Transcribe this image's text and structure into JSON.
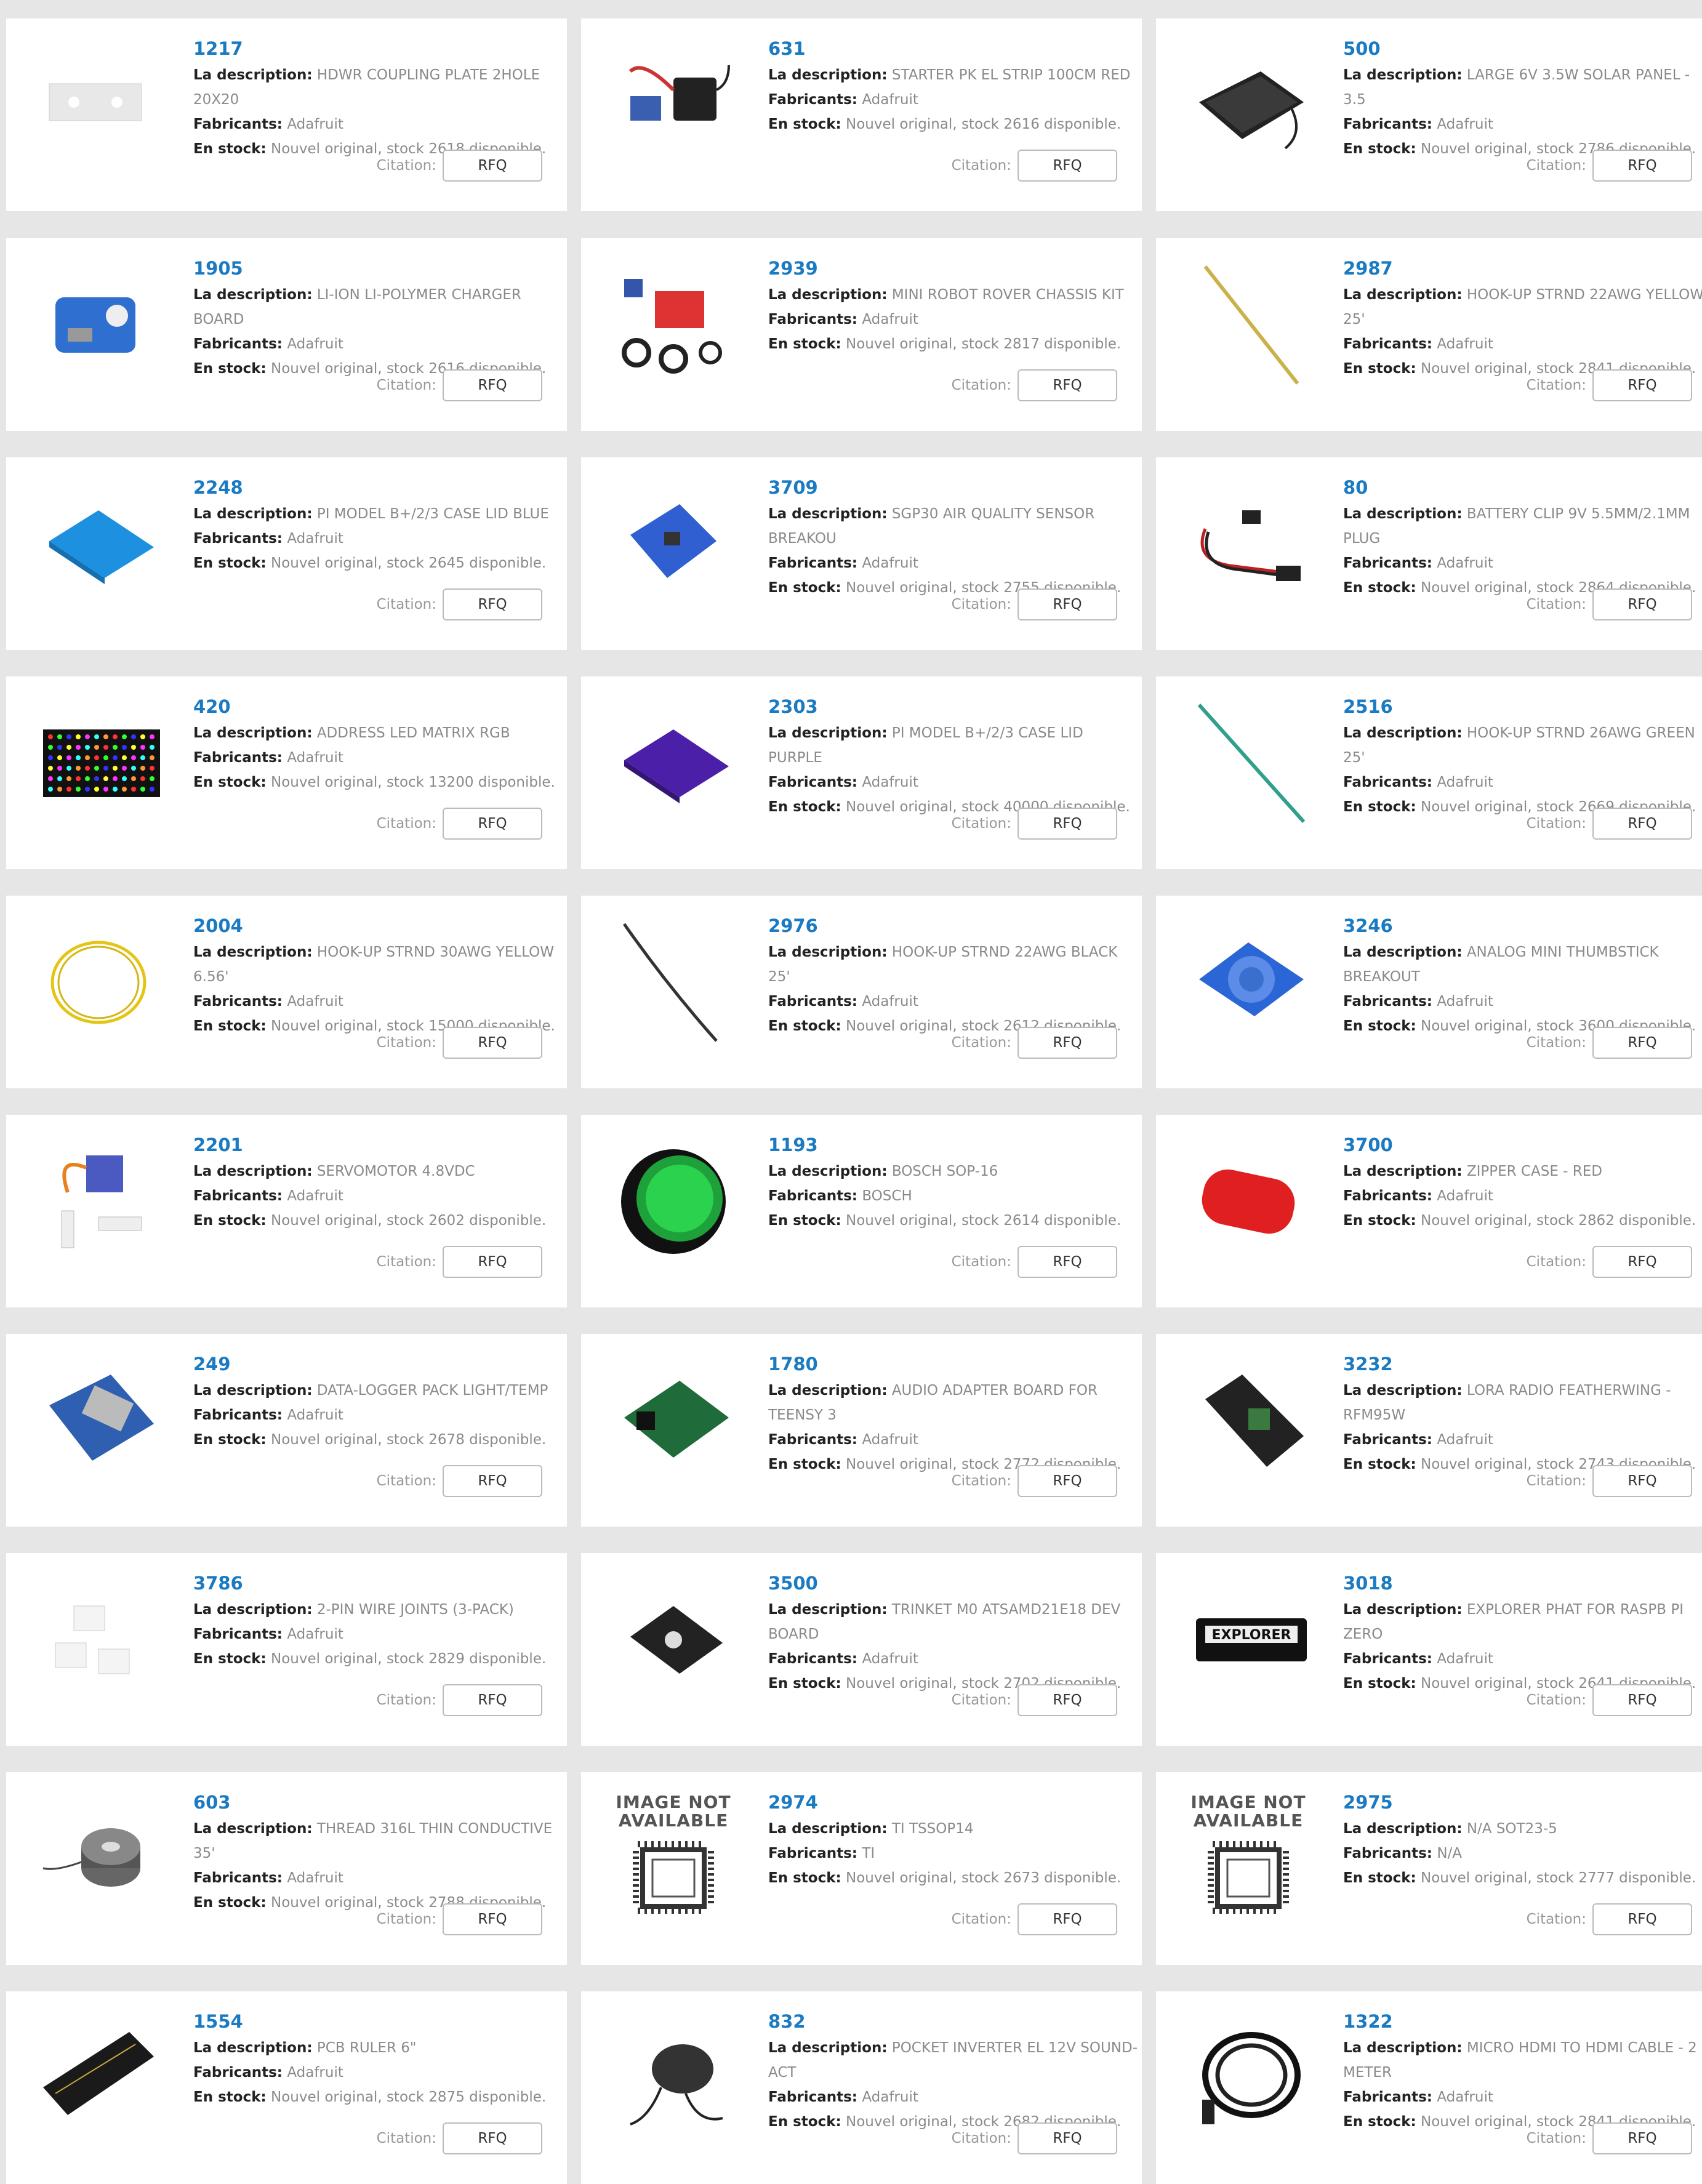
{
  "quote_label": "Citation:",
  "rfq_label": "RFQ",
  "labels": {
    "description": "La description:",
    "manufacturer": "Fabricants:",
    "stock": "En stock:"
  },
  "image_not_available": "IMAGE NOT AVAILABLE",
  "products": [
    {
      "pn": "1217",
      "desc": "HDWR COUPLING PLATE 2HOLE 20X20",
      "mfr": "Adafruit",
      "stock": "Nouvel original, stock 2618 disponible.",
      "icon": "coupling-plate-icon"
    },
    {
      "pn": "631",
      "desc": "STARTER PK EL STRIP 100CM RED",
      "mfr": "Adafruit",
      "stock": "Nouvel original, stock 2616 disponible.",
      "icon": "el-strip-kit-icon"
    },
    {
      "pn": "500",
      "desc": "LARGE 6V 3.5W SOLAR PANEL - 3.5",
      "mfr": "Adafruit",
      "stock": "Nouvel original, stock 2786 disponible.",
      "icon": "solar-panel-icon"
    },
    {
      "pn": "1905",
      "desc": "LI-ION LI-POLYMER CHARGER BOARD",
      "mfr": "Adafruit",
      "stock": "Nouvel original, stock 2616 disponible.",
      "icon": "charger-board-icon"
    },
    {
      "pn": "2939",
      "desc": "MINI ROBOT ROVER CHASSIS KIT",
      "mfr": "Adafruit",
      "stock": "Nouvel original, stock 2817 disponible.",
      "icon": "robot-chassis-icon"
    },
    {
      "pn": "2987",
      "desc": "HOOK-UP STRND 22AWG YELLOW 25'",
      "mfr": "Adafruit",
      "stock": "Nouvel original, stock 2841 disponible.",
      "icon": "yellow-wire-icon"
    },
    {
      "pn": "2248",
      "desc": "PI MODEL B+/2/3 CASE LID BLUE",
      "mfr": "Adafruit",
      "stock": "Nouvel original, stock 2645 disponible.",
      "icon": "blue-case-lid-icon"
    },
    {
      "pn": "3709",
      "desc": "SGP30 AIR QUALITY SENSOR BREAKOU",
      "mfr": "Adafruit",
      "stock": "Nouvel original, stock 2755 disponible.",
      "icon": "sensor-breakout-icon"
    },
    {
      "pn": "80",
      "desc": "BATTERY CLIP 9V 5.5MM/2.1MM PLUG",
      "mfr": "Adafruit",
      "stock": "Nouvel original, stock 2864 disponible.",
      "icon": "battery-clip-icon"
    },
    {
      "pn": "420",
      "desc": "ADDRESS LED MATRIX RGB",
      "mfr": "Adafruit",
      "stock": "Nouvel original, stock 13200 disponible.",
      "icon": "led-matrix-icon"
    },
    {
      "pn": "2303",
      "desc": "PI MODEL B+/2/3 CASE LID PURPLE",
      "mfr": "Adafruit",
      "stock": "Nouvel original, stock 40000 disponible.",
      "icon": "purple-case-lid-icon"
    },
    {
      "pn": "2516",
      "desc": "HOOK-UP STRND 26AWG GREEN 25'",
      "mfr": "Adafruit",
      "stock": "Nouvel original, stock 2669 disponible.",
      "icon": "green-wire-icon"
    },
    {
      "pn": "2004",
      "desc": "HOOK-UP STRND 30AWG YELLOW 6.56'",
      "mfr": "Adafruit",
      "stock": "Nouvel original, stock 15000 disponible.",
      "icon": "yellow-wire-coil-icon"
    },
    {
      "pn": "2976",
      "desc": "HOOK-UP STRND 22AWG BLACK 25'",
      "mfr": "Adafruit",
      "stock": "Nouvel original, stock 2612 disponible.",
      "icon": "black-wire-icon"
    },
    {
      "pn": "3246",
      "desc": "ANALOG MINI THUMBSTICK BREAKOUT",
      "mfr": "Adafruit",
      "stock": "Nouvel original, stock 3600 disponible.",
      "icon": "thumbstick-breakout-icon"
    },
    {
      "pn": "2201",
      "desc": "SERVOMOTOR 4.8VDC",
      "mfr": "Adafruit",
      "stock": "Nouvel original, stock 2602 disponible.",
      "icon": "servo-icon"
    },
    {
      "pn": "1193",
      "desc": "BOSCH SOP-16",
      "mfr": "BOSCH",
      "stock": "Nouvel original, stock 2614 disponible.",
      "icon": "green-button-icon"
    },
    {
      "pn": "3700",
      "desc": "ZIPPER CASE - RED",
      "mfr": "Adafruit",
      "stock": "Nouvel original, stock 2862 disponible.",
      "icon": "red-zipper-case-icon"
    },
    {
      "pn": "249",
      "desc": "DATA-LOGGER PACK LIGHT/TEMP",
      "mfr": "Adafruit",
      "stock": "Nouvel original, stock 2678 disponible.",
      "icon": "data-logger-icon"
    },
    {
      "pn": "1780",
      "desc": "AUDIO ADAPTER BOARD FOR TEENSY 3",
      "mfr": "Adafruit",
      "stock": "Nouvel original, stock 2772 disponible.",
      "icon": "audio-board-icon"
    },
    {
      "pn": "3232",
      "desc": "LORA RADIO FEATHERWING - RFM95W",
      "mfr": "Adafruit",
      "stock": "Nouvel original, stock 2743 disponible.",
      "icon": "featherwing-icon"
    },
    {
      "pn": "3786",
      "desc": "2-PIN WIRE JOINTS (3-PACK)",
      "mfr": "Adafruit",
      "stock": "Nouvel original, stock 2829 disponible.",
      "icon": "wire-joints-icon"
    },
    {
      "pn": "3500",
      "desc": "TRINKET M0 ATSAMD21E18 DEV BOARD",
      "mfr": "Adafruit",
      "stock": "Nouvel original, stock 2702 disponible.",
      "icon": "trinket-board-icon"
    },
    {
      "pn": "3018",
      "desc": "EXPLORER PHAT FOR RASPB PI ZERO",
      "mfr": "Adafruit",
      "stock": "Nouvel original, stock 2641 disponible.",
      "icon": "explorer-phat-icon",
      "image_text": "EXPLORER"
    },
    {
      "pn": "603",
      "desc": "THREAD 316L THIN CONDUCTIVE 35'",
      "mfr": "Adafruit",
      "stock": "Nouvel original, stock 2788 disponible.",
      "icon": "thread-spool-icon"
    },
    {
      "pn": "2974",
      "desc": "TI TSSOP14",
      "mfr": "TI",
      "stock": "Nouvel original, stock 2673 disponible.",
      "icon": "image-not-available-icon"
    },
    {
      "pn": "2975",
      "desc": "N/A SOT23-5",
      "mfr": "N/A",
      "stock": "Nouvel original, stock 2777 disponible.",
      "icon": "image-not-available-icon"
    },
    {
      "pn": "1554",
      "desc": "PCB RULER 6\"",
      "mfr": "Adafruit",
      "stock": "Nouvel original, stock 2875 disponible.",
      "icon": "pcb-ruler-icon"
    },
    {
      "pn": "832",
      "desc": "POCKET INVERTER EL 12V SOUND-ACT",
      "mfr": "Adafruit",
      "stock": "Nouvel original, stock 2682 disponible.",
      "icon": "inverter-icon"
    },
    {
      "pn": "1322",
      "desc": "MICRO HDMI TO HDMI CABLE - 2 METER",
      "mfr": "Adafruit",
      "stock": "Nouvel original, stock 2841 disponible.",
      "icon": "hdmi-cable-icon"
    }
  ]
}
